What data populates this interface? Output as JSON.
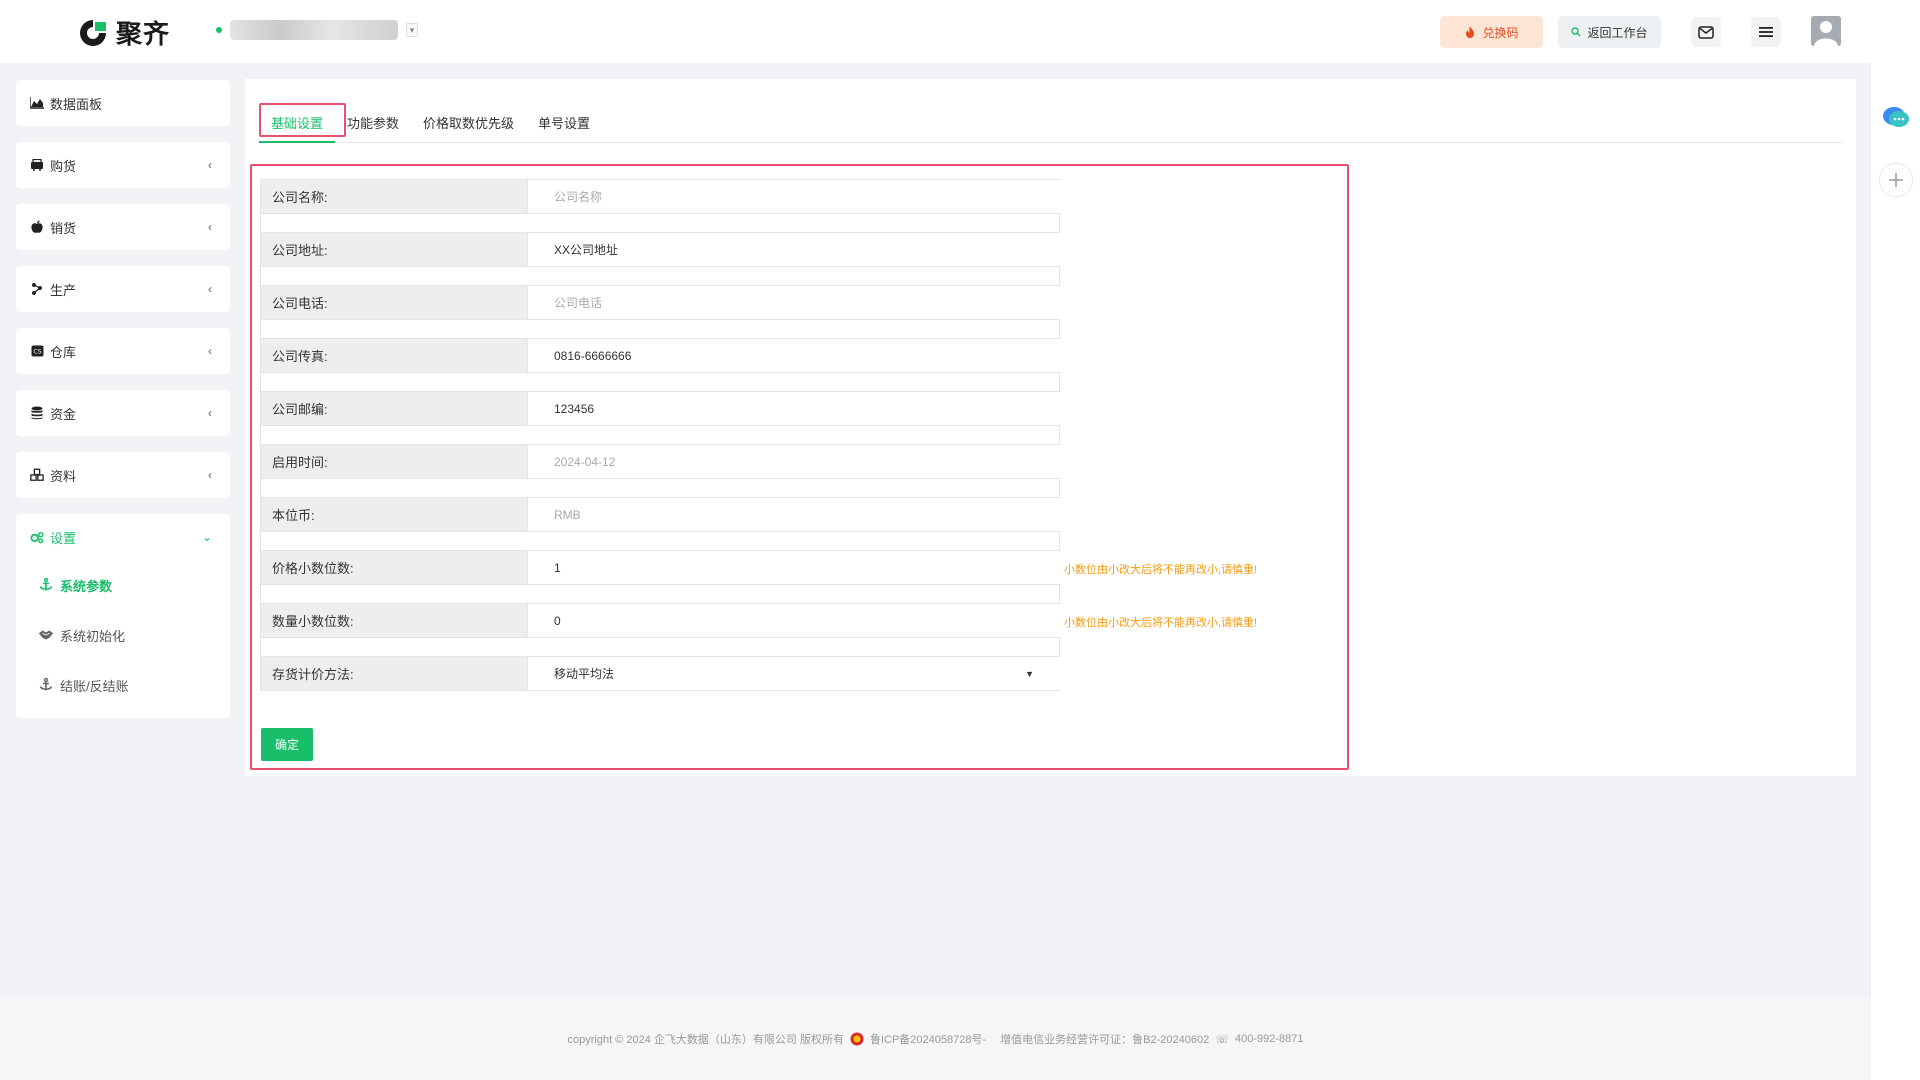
{
  "header": {
    "logo_text": "聚齐",
    "redeem_label": "兑换码",
    "workbench_label": "返回工作台"
  },
  "sidebar": {
    "items": [
      {
        "label": "数据面板",
        "icon": "area-chart-icon"
      },
      {
        "label": "购货",
        "icon": "cart-icon"
      },
      {
        "label": "销货",
        "icon": "apple-icon"
      },
      {
        "label": "生产",
        "icon": "puzzle-icon"
      },
      {
        "label": "仓库",
        "icon": "warehouse-icon"
      },
      {
        "label": "资金",
        "icon": "database-icon"
      },
      {
        "label": "资料",
        "icon": "cubes-icon"
      }
    ],
    "settings": {
      "label": "设置",
      "icon": "gears-icon",
      "children": [
        {
          "label": "系统参数",
          "icon": "anchor-icon",
          "active": true
        },
        {
          "label": "系统初始化",
          "icon": "handshake-icon",
          "active": false
        },
        {
          "label": "结账/反结账",
          "icon": "anchor-icon",
          "active": false
        }
      ]
    }
  },
  "tabs": [
    {
      "label": "基础设置",
      "active": true
    },
    {
      "label": "功能参数",
      "active": false
    },
    {
      "label": "价格取数优先级",
      "active": false
    },
    {
      "label": "单号设置",
      "active": false
    }
  ],
  "form": {
    "rows": [
      {
        "label": "公司名称:",
        "value": "",
        "placeholder": "公司名称",
        "warn": ""
      },
      {
        "label": "公司地址:",
        "value": "XX公司地址",
        "placeholder": "",
        "warn": ""
      },
      {
        "label": "公司电话:",
        "value": "",
        "placeholder": "公司电话",
        "warn": ""
      },
      {
        "label": "公司传真:",
        "value": "0816-6666666",
        "placeholder": "",
        "warn": ""
      },
      {
        "label": "公司邮编:",
        "value": "123456",
        "placeholder": "",
        "warn": ""
      },
      {
        "label": "启用时间:",
        "value": "",
        "placeholder": "2024-04-12",
        "warn": ""
      },
      {
        "label": "本位币:",
        "value": "",
        "placeholder": "RMB",
        "warn": ""
      },
      {
        "label": "价格小数位数:",
        "value": "1",
        "placeholder": "",
        "warn": "小数位由小改大后将不能再改小,请慎重!"
      },
      {
        "label": "数量小数位数:",
        "value": "0",
        "placeholder": "",
        "warn": "小数位由小改大后将不能再改小,请慎重!"
      }
    ],
    "select_row": {
      "label": "存货计价方法:",
      "value": "移动平均法"
    },
    "confirm_label": "确定"
  },
  "footer": {
    "copyright": "copyright © 2024 企飞大数据（山东）有限公司 版权所有",
    "icp": "鲁ICP备2024058728号-",
    "license": "增值电信业务经营许可证：鲁B2-20240602",
    "phone": "400-992-8871"
  },
  "colors": {
    "primary": "#19be6b",
    "highlight": "#e8506d",
    "warn": "#f39c12"
  }
}
